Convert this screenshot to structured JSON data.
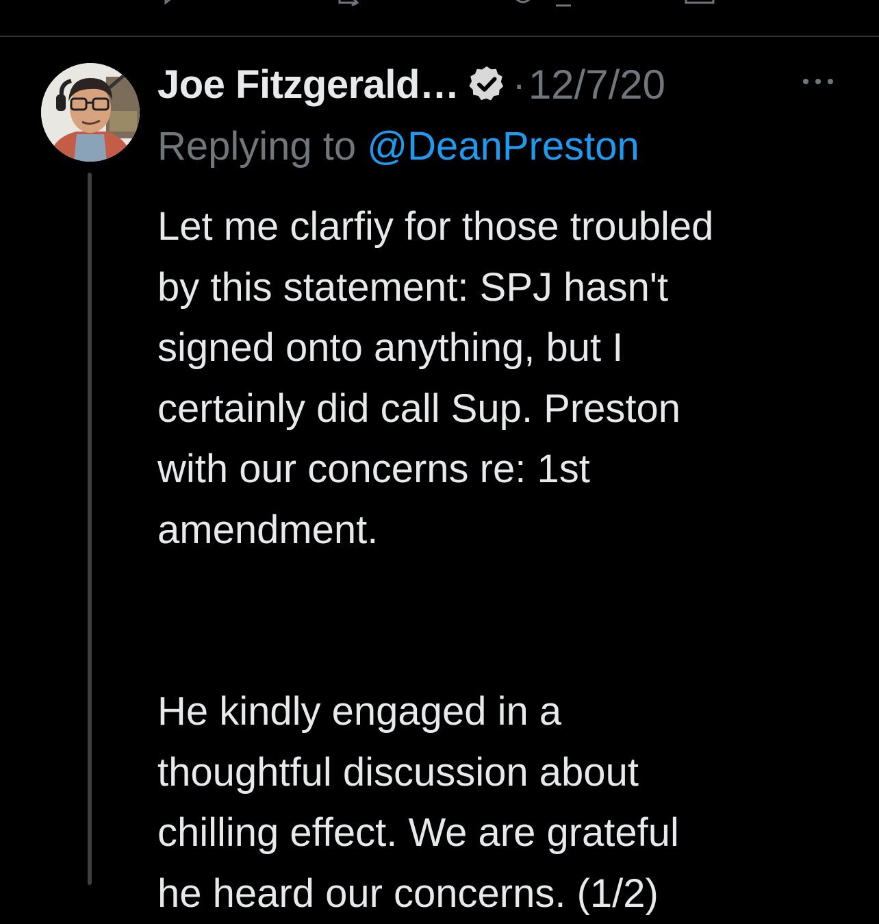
{
  "action_bar": {
    "icons": [
      "reply-icon",
      "retweet-icon",
      "like-icon",
      "share-icon"
    ]
  },
  "tweet": {
    "author_name": "Joe Fitzgerald…",
    "verified": true,
    "separator": "·",
    "date": "12/7/20",
    "replying_prefix": "Replying to",
    "replying_handle": "@DeanPreston",
    "paragraph1": [
      "Let me clarfiy for those troubled",
      "by this statement: SPJ hasn't",
      "signed onto anything, but I",
      "certainly did call Sup. Preston",
      "with our concerns re: 1st",
      "amendment."
    ],
    "paragraph2": [
      "He kindly engaged in a",
      "thoughtful discussion about",
      "chilling effect. We are grateful",
      "he heard our concerns. (1/2)"
    ]
  },
  "colors": {
    "background": "#000000",
    "text": "#e7e9ea",
    "muted": "#71767b",
    "link": "#1d9bf0",
    "divider": "#2f3336"
  }
}
